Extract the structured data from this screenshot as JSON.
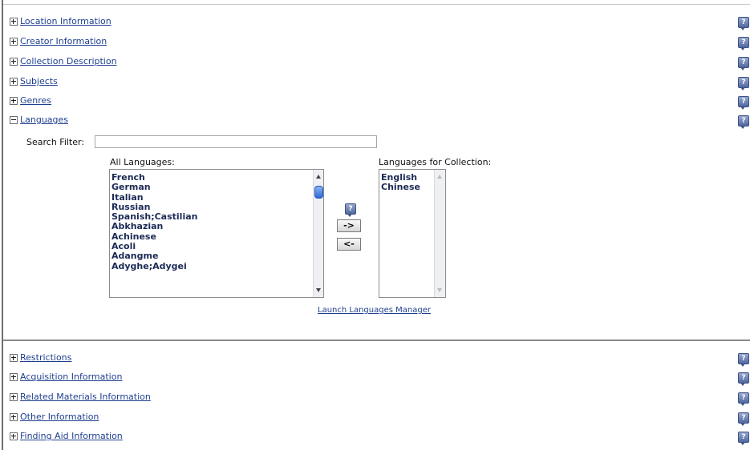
{
  "sections_top": [
    {
      "label": "Location Information",
      "state": "collapsed"
    },
    {
      "label": "Creator Information",
      "state": "collapsed"
    },
    {
      "label": "Collection Description",
      "state": "collapsed"
    },
    {
      "label": "Subjects",
      "state": "collapsed"
    },
    {
      "label": "Genres",
      "state": "collapsed"
    },
    {
      "label": "Languages",
      "state": "expanded"
    }
  ],
  "languages_panel": {
    "search_filter_label": "Search Filter:",
    "search_filter_value": "",
    "all_languages_label": "All Languages:",
    "all_languages": [
      "French",
      "German",
      "Italian",
      "Russian",
      "Spanish;Castilian",
      "Abkhazian",
      "Achinese",
      "Acoli",
      "Adangme",
      "Adyghe;Adygei"
    ],
    "collection_languages_label": "Languages for Collection:",
    "collection_languages": [
      "English",
      "Chinese"
    ],
    "add_button": "->",
    "remove_button": "<-",
    "manager_link": "Launch Languages Manager",
    "help_glyph": "?"
  },
  "sections_bottom": [
    {
      "label": "Restrictions",
      "state": "collapsed"
    },
    {
      "label": "Acquisition Information",
      "state": "collapsed"
    },
    {
      "label": "Related Materials Information",
      "state": "collapsed"
    },
    {
      "label": "Other Information",
      "state": "collapsed"
    },
    {
      "label": "Finding Aid Information",
      "state": "collapsed"
    }
  ],
  "icons": {
    "toggle_collapsed": "plus-box-icon",
    "toggle_expanded": "minus-box-icon",
    "help": "help-icon"
  },
  "colors": {
    "link": "#1f3f8f",
    "list_text": "#1b2a55",
    "help_icon": "#50689f",
    "scroll_thumb": "#2e6ad8"
  }
}
